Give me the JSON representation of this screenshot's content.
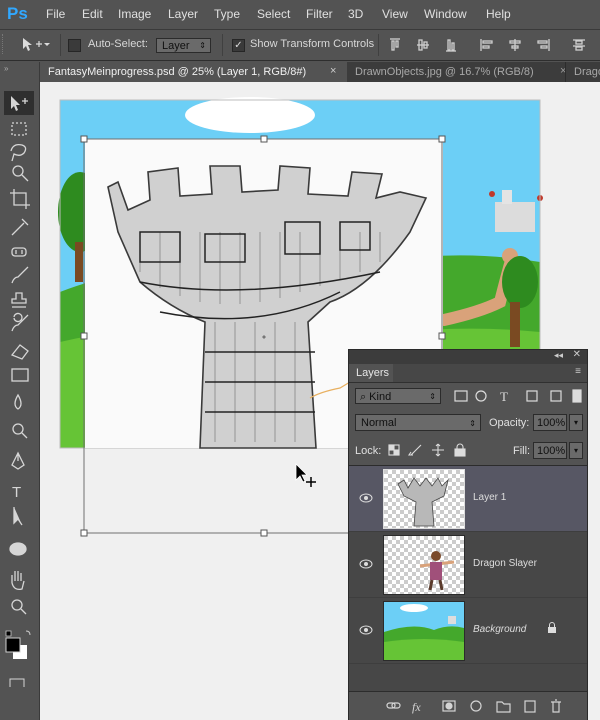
{
  "app": {
    "logo": "Ps"
  },
  "menu": [
    "File",
    "Edit",
    "Image",
    "Layer",
    "Type",
    "Select",
    "Filter",
    "3D",
    "View",
    "Window",
    "Help"
  ],
  "options": {
    "auto_select_label": "Auto-Select:",
    "auto_select_target": "Layer",
    "show_transform_label": "Show Transform Controls",
    "show_transform_checked": true
  },
  "tabs": [
    {
      "label": "FantasyMeinprogress.psd @ 25% (Layer 1, RGB/8#)",
      "active": true
    },
    {
      "label": "DrawnObjects.jpg @ 16.7% (RGB/8)",
      "active": false
    },
    {
      "label": "Drago",
      "active": false
    }
  ],
  "layers_panel": {
    "title": "Layers",
    "filter_kind": "Kind",
    "blend_mode": "Normal",
    "opacity_label": "Opacity:",
    "opacity_value": "100%",
    "lock_label": "Lock:",
    "fill_label": "Fill:",
    "fill_value": "100%",
    "layers": [
      {
        "name": "Layer 1",
        "selected": true
      },
      {
        "name": "Dragon Slayer",
        "selected": false
      },
      {
        "name": "Background",
        "selected": false,
        "locked": true
      }
    ]
  },
  "tools": [
    "move-tool",
    "marquee-tool",
    "lasso-tool",
    "quick-select-tool",
    "crop-tool",
    "eyedropper-tool",
    "healing-tool",
    "brush-tool",
    "clone-stamp-tool",
    "history-brush-tool",
    "eraser-tool",
    "gradient-tool",
    "blur-tool",
    "dodge-tool",
    "pen-tool",
    "type-tool",
    "path-select-tool",
    "shape-tool",
    "hand-tool",
    "zoom-tool"
  ],
  "colors": {
    "foreground": "#000000",
    "background": "#ffffff",
    "accent": "#31a8ff",
    "selected_layer": "#575764"
  }
}
